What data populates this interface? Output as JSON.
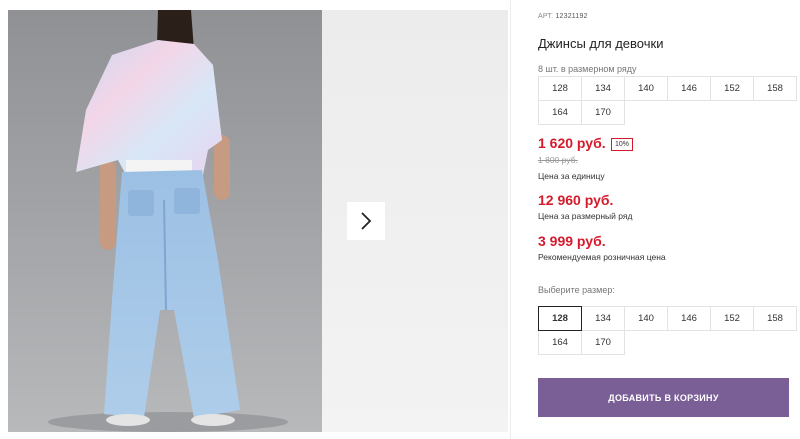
{
  "product": {
    "art_label": "АРТ.",
    "art_value": "12321192",
    "title": "Джинсы для девочки",
    "pack_label": "8 шт. в размерном ряду",
    "pack_sizes": [
      "128",
      "134",
      "140",
      "146",
      "152",
      "158",
      "164",
      "170"
    ],
    "price_unit": "1 620 руб.",
    "discount_badge": "10%",
    "old_price": "1 800 руб.",
    "price_unit_caption": "Цена за единицу",
    "price_pack": "12 960 руб.",
    "price_pack_caption": "Цена за размерный ряд",
    "price_retail": "3 999 руб.",
    "price_retail_caption": "Рекомендуемая розничная цена",
    "choose_size_label": "Выберите размер:",
    "sizes": [
      "128",
      "134",
      "140",
      "146",
      "152",
      "158",
      "164",
      "170"
    ],
    "selected_size": "128",
    "add_to_cart": "ДОБАВИТЬ В КОРЗИНУ"
  },
  "colors": {
    "price_red": "#d51a2b",
    "button_purple": "#7a5f97"
  },
  "icons": {
    "next": "chevron-right-icon"
  }
}
